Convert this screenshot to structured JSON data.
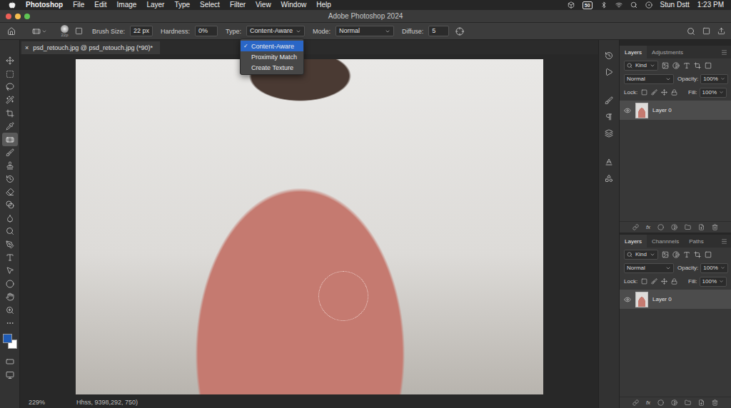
{
  "menubar": {
    "app": "Photoshop",
    "menus": [
      "File",
      "Edit",
      "Image",
      "Layer",
      "Type",
      "Select",
      "Filter",
      "View",
      "Window",
      "Help"
    ],
    "badge": "50",
    "user": "Stun Dstt",
    "time": "1:23 PM"
  },
  "window": {
    "title": "Adobe Photoshop 2024"
  },
  "options_bar": {
    "brush_preview": "22p",
    "fields": [
      {
        "label": "Brush Size:",
        "value": "22 px"
      },
      {
        "label": "Hardness:",
        "value": "0%"
      }
    ],
    "type": {
      "label": "Type:",
      "value": "Content-Aware",
      "expanded": true,
      "check_mark": "✓",
      "options": [
        {
          "label": "Content-Aware",
          "selected": true
        },
        {
          "label": "Proximity Match",
          "selected": false
        },
        {
          "label": "Create Texture",
          "selected": false
        }
      ]
    },
    "mode": {
      "label": "Mode:",
      "value": "Normal"
    },
    "diffuse": {
      "label": "Diffuse:",
      "value": "5"
    }
  },
  "tools": [
    {
      "selected": false
    },
    {
      "selected": false
    },
    {
      "selected": false
    },
    {
      "selected": false
    },
    {
      "selected": false
    },
    {
      "selected": false
    },
    {
      "selected": true
    },
    {
      "selected": false
    },
    {
      "selected": false
    },
    {
      "selected": false
    },
    {
      "selected": false
    },
    {
      "selected": false
    },
    {
      "selected": false
    },
    {
      "selected": false
    },
    {
      "selected": false
    },
    {
      "selected": false
    },
    {
      "selected": false
    },
    {
      "selected": false
    },
    {
      "selected": false
    },
    {
      "selected": false
    },
    {
      "selected": false
    }
  ],
  "swatches": [
    {
      "name": "foreground",
      "color": "#1f5bb5"
    },
    {
      "name": "background",
      "color": "#ffffff"
    }
  ],
  "document": {
    "tab": "psd_retouch.jpg @ psd_retouch.jpg (*90)*",
    "close": "×"
  },
  "panels": [
    {
      "tabs": [
        {
          "label": "Layers",
          "selected": true
        },
        {
          "label": "Adjustments",
          "selected": false
        }
      ],
      "filter": "Kind",
      "blend": "Normal",
      "opacity_label": "Opacity:",
      "opacity": "100%",
      "lock_label": "Lock:",
      "fill_label": "Fill:",
      "fill": "100%",
      "layers": [
        {
          "name": "Layer 0",
          "selected": true,
          "visible": true
        }
      ],
      "fx": "fx"
    },
    {
      "tabs": [
        {
          "label": "Layers",
          "selected": true
        },
        {
          "label": "Channnels",
          "selected": false
        },
        {
          "label": "Paths",
          "selected": false
        }
      ],
      "filter": "Kind",
      "blend": "Normal",
      "opacity_label": "Opacity:",
      "opacity": "100%",
      "lock_label": "Lock:",
      "fill_label": "Fill:",
      "fill": "100%",
      "layers": [
        {
          "name": "Layer 0",
          "selected": true,
          "visible": true
        }
      ],
      "fx": "fx"
    }
  ],
  "status_bar": {
    "zoom": "229%",
    "info": "Hhss, 9398,292, 750)"
  }
}
